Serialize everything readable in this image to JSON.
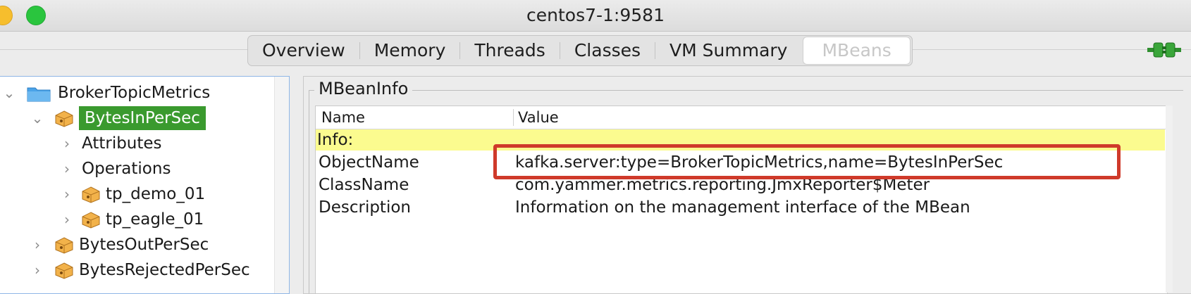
{
  "window": {
    "title": "centos7-1:9581"
  },
  "tabs": [
    {
      "label": "Overview"
    },
    {
      "label": "Memory"
    },
    {
      "label": "Threads"
    },
    {
      "label": "Classes"
    },
    {
      "label": "VM Summary"
    },
    {
      "label": "MBeans",
      "active": true
    }
  ],
  "tree": {
    "items": [
      {
        "label": "BrokerTopicMetrics",
        "icon": "folder-icon",
        "expanded": true
      },
      {
        "label": "BytesInPerSec",
        "icon": "mbean-icon",
        "expanded": true,
        "selected": true
      },
      {
        "label": "Attributes",
        "expanded": false
      },
      {
        "label": "Operations",
        "expanded": false
      },
      {
        "label": "tp_demo_01",
        "icon": "mbean-icon",
        "expanded": false
      },
      {
        "label": "tp_eagle_01",
        "icon": "mbean-icon",
        "expanded": false
      },
      {
        "label": "BytesOutPerSec",
        "icon": "mbean-icon",
        "expanded": false
      },
      {
        "label": "BytesRejectedPerSec",
        "icon": "mbean-icon",
        "expanded": false
      }
    ]
  },
  "mbeaninfo": {
    "title": "MBeanInfo",
    "columns": {
      "name": "Name",
      "value": "Value"
    },
    "section": "Info:",
    "rows": [
      {
        "name": "ObjectName",
        "value": "kafka.server:type=BrokerTopicMetrics,name=BytesInPerSec"
      },
      {
        "name": "ClassName",
        "value": "com.yammer.metrics.reporting.JmxReporter$Meter"
      },
      {
        "name": "Description",
        "value": "Information on the management interface of the MBean"
      }
    ]
  },
  "colors": {
    "selection": "#3a9a2e",
    "info_row": "#fbfb8f",
    "highlight_border": "#cf3a2a",
    "connected_icon": "#3aa63a"
  }
}
